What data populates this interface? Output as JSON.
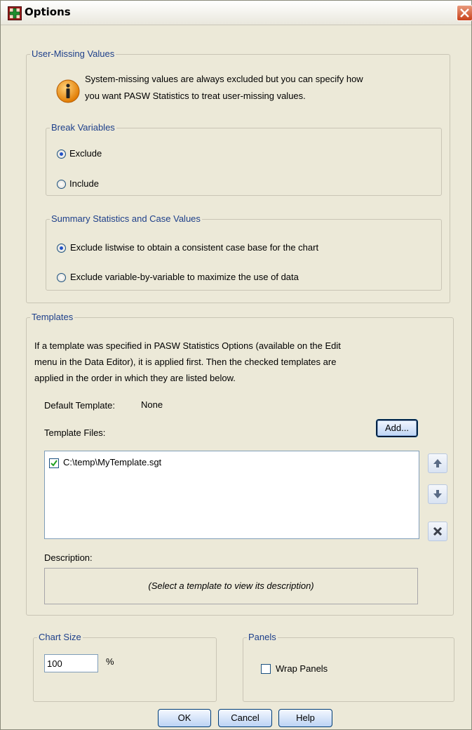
{
  "window": {
    "title": "Options"
  },
  "user_missing": {
    "legend": "User-Missing Values",
    "info_line1": "System-missing values are always excluded but you can specify how",
    "info_line2": "you want PASW Statistics to treat user-missing values.",
    "break_variables": {
      "legend": "Break Variables",
      "options": [
        {
          "label": "Exclude",
          "selected": true
        },
        {
          "label": "Include",
          "selected": false
        }
      ]
    },
    "summary_stats": {
      "legend": "Summary Statistics and Case Values",
      "options": [
        {
          "label": "Exclude listwise to obtain a consistent case base for the chart",
          "selected": true
        },
        {
          "label": "Exclude variable-by-variable to maximize the use of data",
          "selected": false
        }
      ]
    }
  },
  "templates": {
    "legend": "Templates",
    "info_line1": "If a template was specified in PASW Statistics Options (available on the Edit",
    "info_line2": "menu in the Data Editor), it is applied first. Then the checked templates are",
    "info_line3": "applied in the order in which they are listed below.",
    "default_label": "Default Template:",
    "default_value": "None",
    "files_label": "Template Files:",
    "add_button": "Add...",
    "files": [
      {
        "path": "C:\\temp\\MyTemplate.sgt",
        "checked": true
      }
    ],
    "description_label": "Description:",
    "description_placeholder": "(Select a template to view its description)"
  },
  "chart_size": {
    "legend": "Chart Size",
    "value": "100",
    "unit": "%"
  },
  "panels": {
    "legend": "Panels",
    "wrap_label": "Wrap Panels",
    "wrap_checked": false
  },
  "buttons": {
    "ok": "OK",
    "cancel": "Cancel",
    "help": "Help"
  },
  "colors": {
    "legend_text": "#1d3f8a",
    "background": "#ece9d8",
    "close_button": "#c8421c"
  }
}
